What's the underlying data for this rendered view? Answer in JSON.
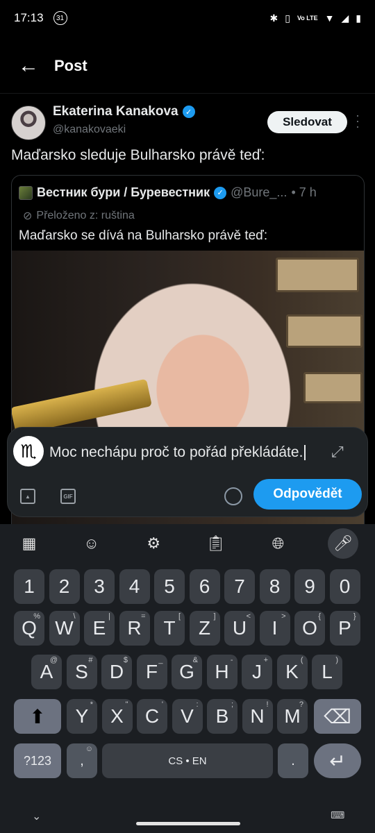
{
  "status_bar": {
    "time": "17:13",
    "calendar_badge": "31",
    "volte": "Vo LTE"
  },
  "appbar": {
    "title": "Post"
  },
  "post": {
    "author_name": "Ekaterina Kanakova",
    "author_handle": "@kanakovaeki",
    "follow_label": "Sledovat",
    "text": "Maďarsko sleduje Bulharsko právě teď:"
  },
  "quoted_post": {
    "author_name": "Вестник бури / Буревестник",
    "author_handle": "@Bure_...",
    "time": "• 7 h",
    "translated_label": "Přeloženo z: ruština",
    "text": "Maďarsko se dívá na Bulharsko právě teď:"
  },
  "composer": {
    "input_value": "Moc nechápu proč to pořád překládáte.",
    "gif_label": "GIF",
    "reply_label": "Odpovědět"
  },
  "keyboard": {
    "number_row": [
      "1",
      "2",
      "3",
      "4",
      "5",
      "6",
      "7",
      "8",
      "9",
      "0"
    ],
    "row1": [
      {
        "k": "Q",
        "s": "%"
      },
      {
        "k": "W",
        "s": "\\"
      },
      {
        "k": "E",
        "s": "|"
      },
      {
        "k": "R",
        "s": "="
      },
      {
        "k": "T",
        "s": "["
      },
      {
        "k": "Z",
        "s": "]"
      },
      {
        "k": "U",
        "s": "<"
      },
      {
        "k": "I",
        "s": ">"
      },
      {
        "k": "O",
        "s": "{"
      },
      {
        "k": "P",
        "s": "}"
      }
    ],
    "row2": [
      {
        "k": "A",
        "s": "@"
      },
      {
        "k": "S",
        "s": "#"
      },
      {
        "k": "D",
        "s": "$"
      },
      {
        "k": "F",
        "s": "_"
      },
      {
        "k": "G",
        "s": "&"
      },
      {
        "k": "H",
        "s": "-"
      },
      {
        "k": "J",
        "s": "+"
      },
      {
        "k": "K",
        "s": "("
      },
      {
        "k": "L",
        "s": ")"
      }
    ],
    "row3": [
      {
        "k": "Y",
        "s": "*"
      },
      {
        "k": "X",
        "s": "\""
      },
      {
        "k": "C",
        "s": "'"
      },
      {
        "k": "V",
        "s": ":"
      },
      {
        "k": "B",
        "s": ";"
      },
      {
        "k": "N",
        "s": "!"
      },
      {
        "k": "M",
        "s": "?"
      }
    ],
    "symbols_label": "?123",
    "emoji_comma": ",",
    "space_label": "CS • EN",
    "period": "."
  }
}
